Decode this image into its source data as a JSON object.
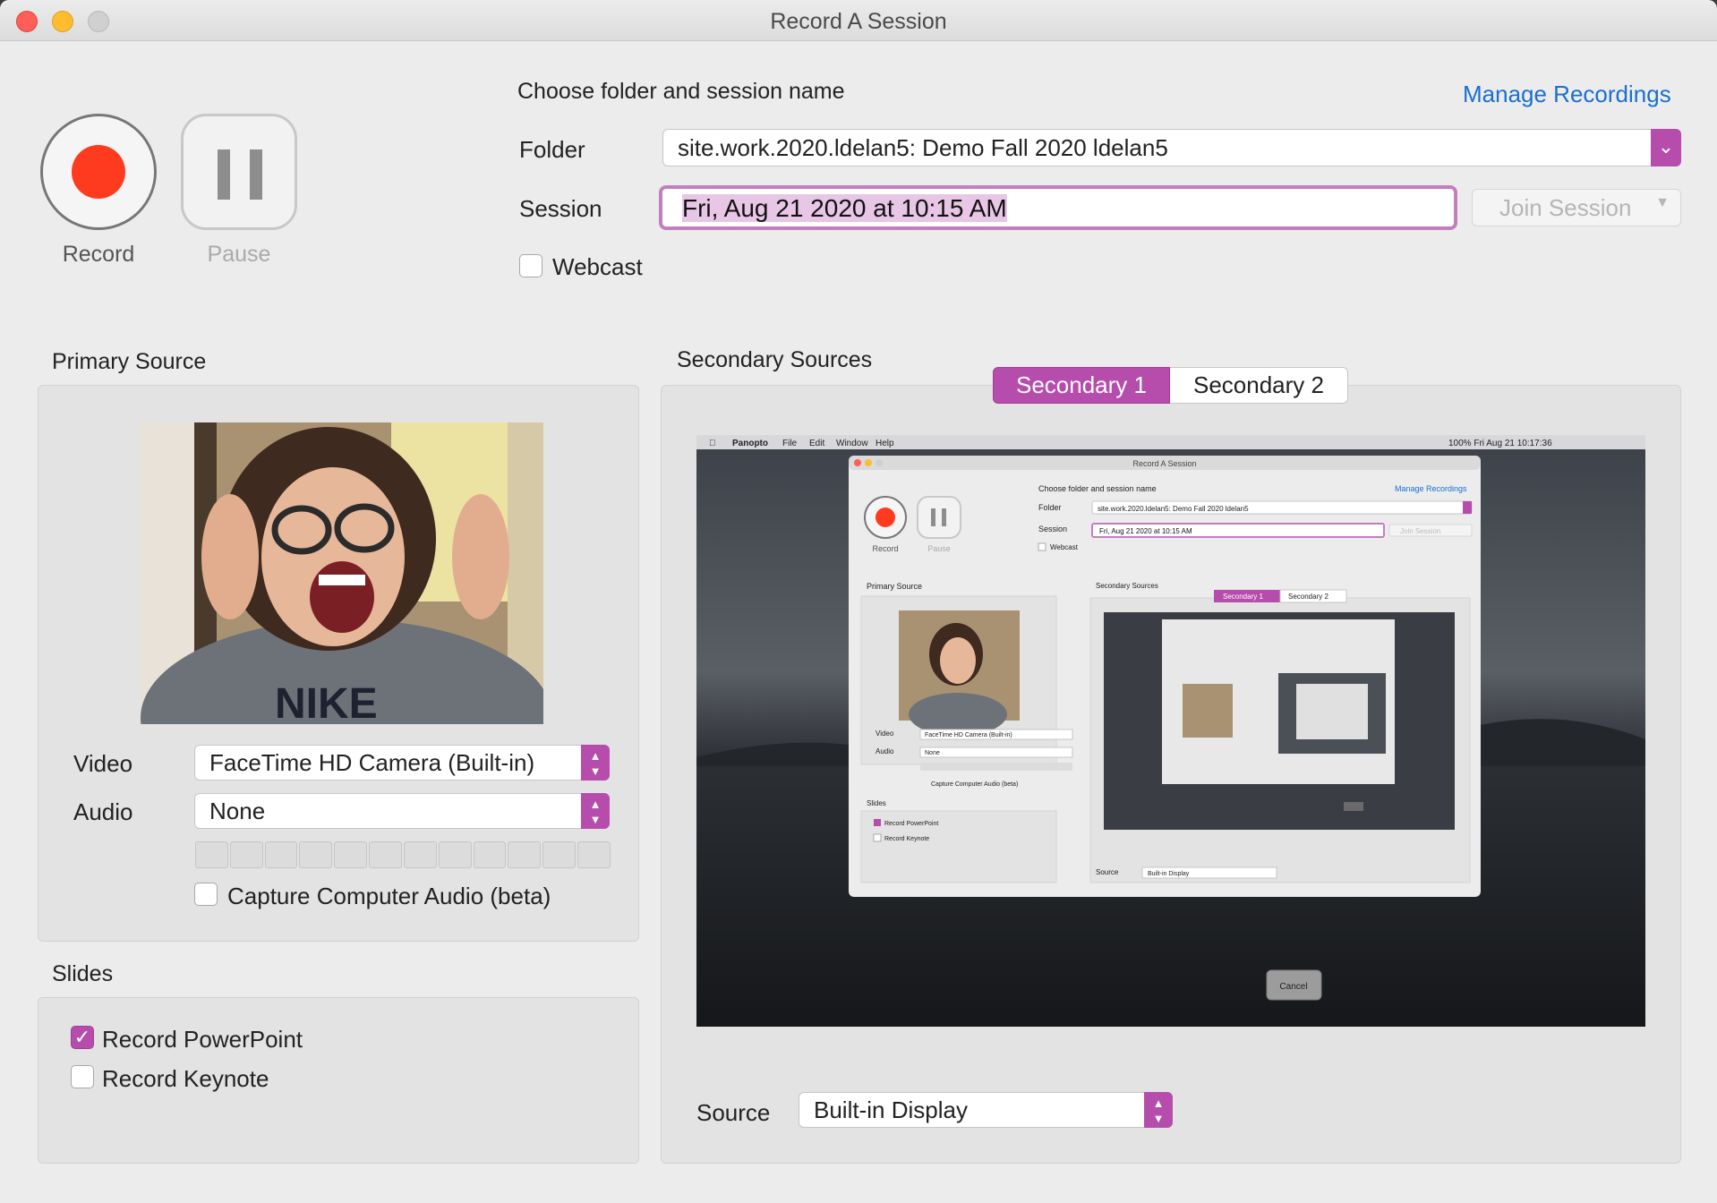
{
  "window": {
    "title": "Record A Session"
  },
  "controls": {
    "record_label": "Record",
    "pause_label": "Pause"
  },
  "session_setup": {
    "heading": "Choose folder and session name",
    "manage_link": "Manage Recordings",
    "folder_label": "Folder",
    "folder_value": "site.work.2020.ldelan5: Demo Fall 2020 ldelan5",
    "session_label": "Session",
    "session_value": "Fri, Aug 21 2020 at 10:15 AM",
    "join_label": "Join Session",
    "webcast_label": "Webcast",
    "webcast_checked": false
  },
  "primary": {
    "heading": "Primary Source",
    "video_label": "Video",
    "video_value": "FaceTime HD Camera (Built-in)",
    "audio_label": "Audio",
    "audio_value": "None",
    "capture_label": "Capture Computer Audio (beta)",
    "capture_checked": false
  },
  "slides": {
    "heading": "Slides",
    "powerpoint_label": "Record PowerPoint",
    "powerpoint_checked": true,
    "keynote_label": "Record Keynote",
    "keynote_checked": false
  },
  "secondary": {
    "heading": "Secondary Sources",
    "tabs": [
      "Secondary 1",
      "Secondary 2"
    ],
    "active_tab": "Secondary 1",
    "source_label": "Source",
    "source_value": "Built-in Display"
  },
  "preview_screen": {
    "menubar_items": [
      "Panopto",
      "File",
      "Edit",
      "Window",
      "Help"
    ],
    "menubar_right": "100%  Fri Aug 21  10:17:36",
    "cancel_label": "Cancel",
    "nested": {
      "title": "Record A Session",
      "heading": "Choose folder and session name",
      "manage": "Manage Recordings",
      "folder_label": "Folder",
      "folder_value": "site.work.2020.ldelan5: Demo Fall 2020 ldelan5",
      "session_label": "Session",
      "session_value": "Fri, Aug 21 2020 at 10:15 AM",
      "join": "Join Session",
      "webcast": "Webcast",
      "record": "Record",
      "pause": "Pause",
      "primary": "Primary Source",
      "secondary": "Secondary Sources",
      "tab1": "Secondary 1",
      "tab2": "Secondary 2",
      "video_label": "Video",
      "video_value": "FaceTime HD Camera (Built-in)",
      "audio_label": "Audio",
      "audio_value": "None",
      "capture": "Capture Computer Audio (beta)",
      "slides": "Slides",
      "ppt": "Record PowerPoint",
      "keynote": "Record Keynote",
      "source_label": "Source",
      "source_value": "Built-in Display"
    }
  },
  "colors": {
    "accent": "#b64dac",
    "record_red": "#fe3b1f",
    "link": "#1a6fd1"
  }
}
